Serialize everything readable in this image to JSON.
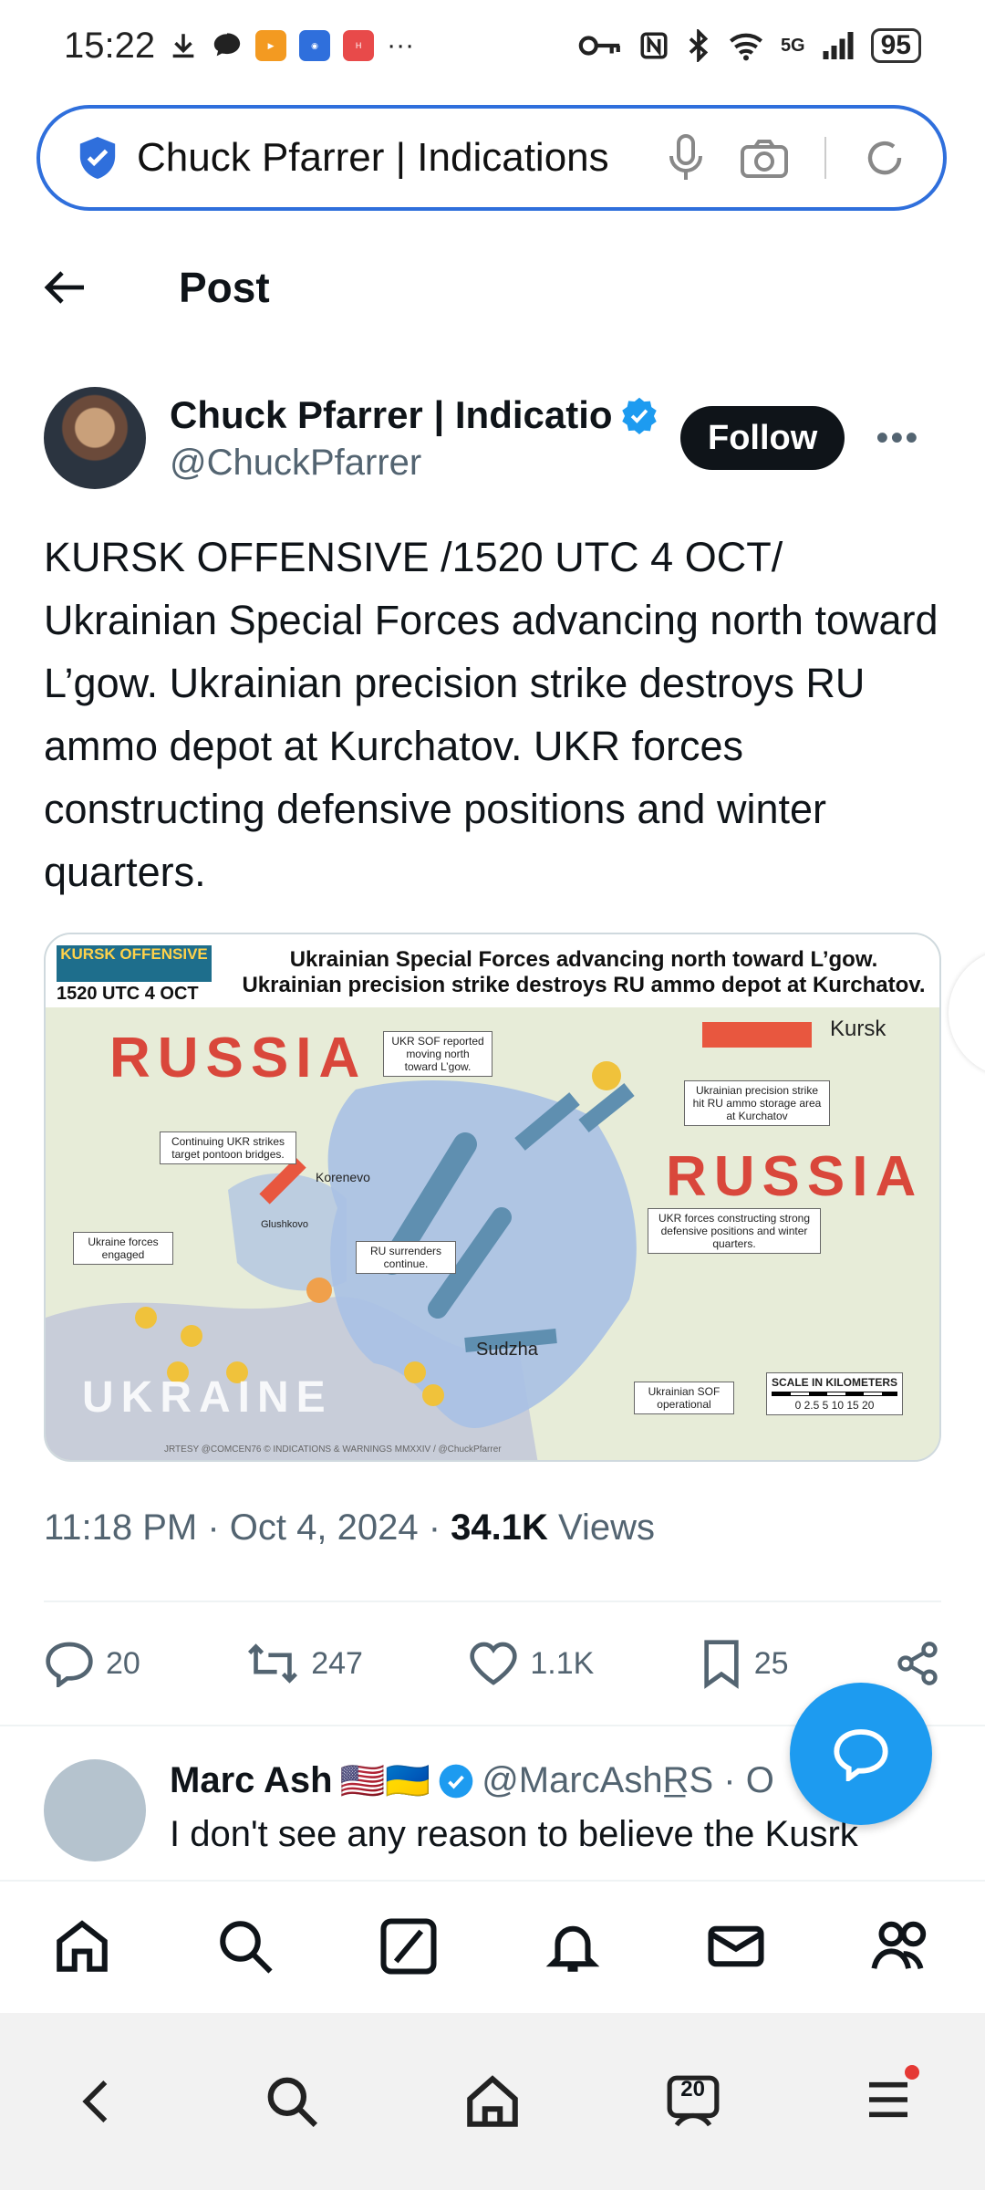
{
  "status_bar": {
    "time": "15:22",
    "network": "5G",
    "battery": "95"
  },
  "url_bar": {
    "title": "Chuck Pfarrer | Indications"
  },
  "header": {
    "title": "Post"
  },
  "author": {
    "name": "Chuck Pfarrer | Indicatio",
    "handle": "@ChuckPfarrer",
    "follow_label": "Follow"
  },
  "tweet": {
    "text": "KURSK OFFENSIVE /1520 UTC 4 OCT/ Ukrainian Special Forces advancing north toward L’gow. Ukrainian precision strike destroys RU ammo depot at Kurchatov. UKR forces constructing defensive positions and winter quarters."
  },
  "map": {
    "badge": "KURSK OFFENSIVE",
    "badge_date": "1520 UTC 4 OCT",
    "headline_1": "Ukrainian Special Forces advancing north toward L’gow.",
    "headline_2": "Ukrainian precision strike destroys RU ammo depot at Kurchatov.",
    "label_russia_1": "RUSSIA",
    "label_russia_2": "RUSSIA",
    "label_ukraine": "UKRAINE",
    "town_kursk": "Kursk",
    "town_sudzha": "Sudzha",
    "town_korenevo": "Korenevo",
    "town_glushkovo": "Glushkovo",
    "callout_sof": "UKR SOF reported moving north toward L’gow.",
    "callout_pontoon": "Continuing UKR strikes target pontoon bridges.",
    "callout_engaged": "Ukraine forces engaged",
    "callout_surrender": "RU surrenders continue.",
    "callout_strike": "Ukrainian precision strike hit RU ammo storage area at Kurchatov",
    "callout_defense": "UKR forces constructing strong defensive positions and winter quarters.",
    "callout_sof_op": "Ukrainian SOF operational",
    "scale_title": "SCALE IN KILOMETERS",
    "scale_ticks": "0  2.5  5  10  15  20",
    "credit": "JRTESY @COMCEN76 © INDICATIONS & WARNINGS MMXXIV / @ChuckPfarrer"
  },
  "meta": {
    "time": "11:18 PM",
    "date": "Oct 4, 2024",
    "views_count": "34.1K",
    "views_label": "Views"
  },
  "actions": {
    "replies": "20",
    "reposts": "247",
    "likes": "1.1K",
    "bookmarks": "25"
  },
  "reply": {
    "name": "Marc Ash",
    "flags": "🇺🇸🇺🇦",
    "handle": "@MarcAshR̲S · O",
    "text": "I don't see any reason to believe the Kusrk"
  },
  "browser_nav": {
    "tab_count": "20"
  }
}
